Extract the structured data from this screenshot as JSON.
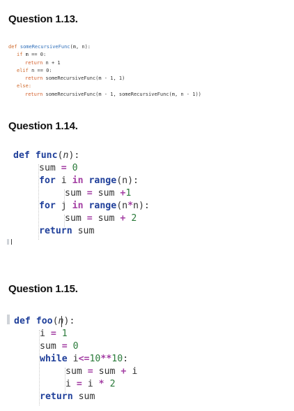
{
  "q113": {
    "heading": "Question 1.13.",
    "lines": [
      {
        "indent": 0,
        "parts": [
          [
            "kw",
            "def "
          ],
          [
            "fn",
            "someRecursiveFunc"
          ],
          [
            "nm",
            "(m, n):"
          ]
        ]
      },
      {
        "indent": 1,
        "parts": [
          [
            "kw",
            "if "
          ],
          [
            "nm",
            "m == 0:"
          ]
        ]
      },
      {
        "indent": 2,
        "parts": [
          [
            "ret",
            "return "
          ],
          [
            "nm",
            "n + 1"
          ]
        ]
      },
      {
        "indent": 1,
        "parts": [
          [
            "kw",
            "elif "
          ],
          [
            "nm",
            "n == 0:"
          ]
        ]
      },
      {
        "indent": 2,
        "parts": [
          [
            "ret",
            "return "
          ],
          [
            "nm",
            "someRecursiveFunc(m - 1, 1)"
          ]
        ]
      },
      {
        "indent": 1,
        "parts": [
          [
            "kw",
            "else:"
          ]
        ]
      },
      {
        "indent": 2,
        "parts": [
          [
            "ret",
            "return "
          ],
          [
            "nm",
            "someRecursiveFunc(m - 1, someRecursiveFunc(m, n - 1))"
          ]
        ]
      }
    ]
  },
  "q114": {
    "heading": "Question 1.14.",
    "lines": [
      {
        "indent": 0,
        "parts": [
          [
            "kwb",
            "def "
          ],
          [
            "fnb",
            "func"
          ],
          [
            "txt",
            "("
          ],
          [
            "param",
            "n"
          ],
          [
            "txt",
            "):"
          ]
        ]
      },
      {
        "indent": 1,
        "parts": [
          [
            "txt",
            "sum "
          ],
          [
            "op",
            "="
          ],
          [
            "txt",
            " "
          ],
          [
            "num",
            "0"
          ]
        ]
      },
      {
        "indent": 1,
        "parts": [
          [
            "kwb",
            "for "
          ],
          [
            "txt",
            "i "
          ],
          [
            "op",
            "in "
          ],
          [
            "bi",
            "range"
          ],
          [
            "txt",
            "(n):"
          ]
        ]
      },
      {
        "indent": 2,
        "parts": [
          [
            "txt",
            "sum "
          ],
          [
            "op",
            "="
          ],
          [
            "txt",
            " sum "
          ],
          [
            "op",
            "+"
          ],
          [
            "num",
            "1"
          ]
        ]
      },
      {
        "indent": 1,
        "parts": [
          [
            "kwb",
            "for "
          ],
          [
            "txt",
            "j "
          ],
          [
            "op",
            "in "
          ],
          [
            "bi",
            "range"
          ],
          [
            "txt",
            "(n"
          ],
          [
            "op",
            "*"
          ],
          [
            "txt",
            "n):"
          ]
        ]
      },
      {
        "indent": 2,
        "parts": [
          [
            "txt",
            "sum "
          ],
          [
            "op",
            "="
          ],
          [
            "txt",
            " sum "
          ],
          [
            "op",
            "+"
          ],
          [
            "txt",
            " "
          ],
          [
            "num",
            "2"
          ]
        ]
      },
      {
        "indent": 1,
        "parts": [
          [
            "kwb",
            "return "
          ],
          [
            "txt",
            "sum"
          ]
        ]
      }
    ]
  },
  "q115": {
    "heading": "Question 1.15.",
    "lines": [
      {
        "indent": 0,
        "parts": [
          [
            "kwb",
            "def "
          ],
          [
            "fnb",
            "foo"
          ],
          [
            "txt",
            "("
          ],
          [
            "param",
            "n"
          ],
          [
            "txt",
            "):"
          ]
        ]
      },
      {
        "indent": 1,
        "parts": [
          [
            "txt",
            "i "
          ],
          [
            "op",
            "="
          ],
          [
            "txt",
            " "
          ],
          [
            "num",
            "1"
          ]
        ]
      },
      {
        "indent": 1,
        "parts": [
          [
            "txt",
            "sum "
          ],
          [
            "op",
            "="
          ],
          [
            "txt",
            " "
          ],
          [
            "num",
            "0"
          ]
        ]
      },
      {
        "indent": 1,
        "parts": [
          [
            "kwb",
            "while "
          ],
          [
            "txt",
            "i"
          ],
          [
            "op",
            "<="
          ],
          [
            "num",
            "10"
          ],
          [
            "op",
            "**"
          ],
          [
            "num",
            "10"
          ],
          [
            "txt",
            ":"
          ]
        ]
      },
      {
        "indent": 2,
        "parts": [
          [
            "txt",
            "sum "
          ],
          [
            "op",
            "="
          ],
          [
            "txt",
            " sum "
          ],
          [
            "op",
            "+"
          ],
          [
            "txt",
            " i"
          ]
        ]
      },
      {
        "indent": 2,
        "parts": [
          [
            "txt",
            "i "
          ],
          [
            "op",
            "="
          ],
          [
            "txt",
            " i "
          ],
          [
            "op",
            "*"
          ],
          [
            "txt",
            " "
          ],
          [
            "num",
            "2"
          ]
        ]
      },
      {
        "indent": 1,
        "parts": [
          [
            "kwb",
            "return "
          ],
          [
            "txt",
            "sum"
          ]
        ]
      }
    ]
  }
}
